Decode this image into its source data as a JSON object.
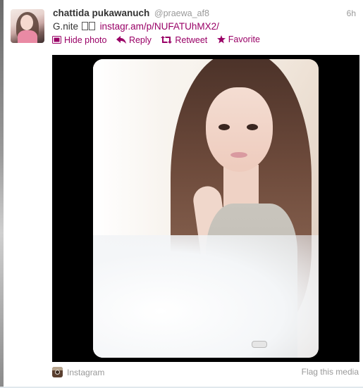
{
  "tweet": {
    "fullname": "chattida pukawanuch",
    "username": "@praewa_af8",
    "time": "6h",
    "text": "G.nite",
    "link": "instagr.am/p/NUFATUhMX2/"
  },
  "actions": {
    "hide_photo": "Hide photo",
    "reply": "Reply",
    "retweet": "Retweet",
    "favorite": "Favorite"
  },
  "media": {
    "source": "Instagram",
    "flag": "Flag this media"
  },
  "colors": {
    "link": "#990066",
    "muted": "#999999",
    "text": "#333333"
  },
  "icons": [
    "photo-icon",
    "reply-icon",
    "retweet-icon",
    "star-icon",
    "instagram-icon"
  ]
}
